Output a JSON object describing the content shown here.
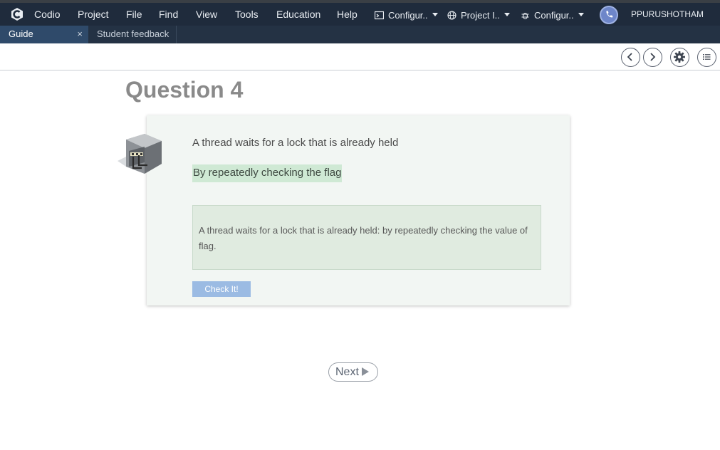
{
  "menubar": {
    "items": [
      "Codio",
      "Project",
      "File",
      "Find",
      "View",
      "Tools",
      "Education",
      "Help"
    ],
    "dropdowns": [
      {
        "label": "Configur..",
        "icon": "terminal-icon"
      },
      {
        "label": "Project I..",
        "icon": "globe-icon"
      },
      {
        "label": "Configur..",
        "icon": "bug-icon"
      }
    ],
    "user": "PPURUSHOTHAM"
  },
  "tabs": [
    {
      "label": "Guide",
      "close": "×",
      "active": true
    },
    {
      "label": "Student feedback",
      "active": false
    }
  ],
  "toolbar": {
    "icons": [
      "chevron-left-icon",
      "chevron-right-icon",
      "gear-icon",
      "list-icon"
    ]
  },
  "guide": {
    "title": "Question 4",
    "question": "A thread waits for a lock that is already held",
    "selected_answer": "By repeatedly checking the flag",
    "feedback": "A thread waits for a lock that is already held: by repeatedly checking the value of flag.",
    "check_button": "Check It!",
    "next_button": "Next"
  },
  "colors": {
    "menubar_bg": "#1f2b3c",
    "tab_active_bg": "#2f4a6a",
    "answer_highlight": "#cfe9d4",
    "check_button": "#9bbbe3"
  }
}
